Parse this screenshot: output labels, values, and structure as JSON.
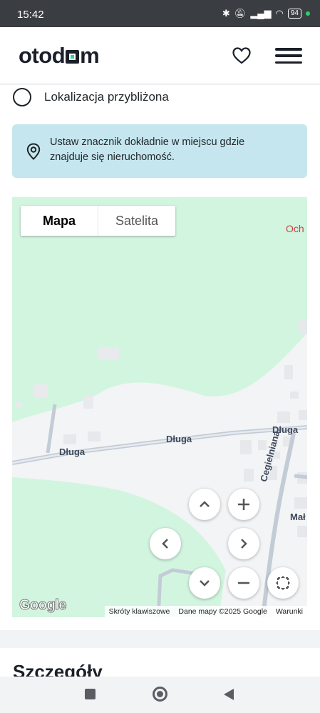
{
  "status_bar": {
    "time": "15:42",
    "battery": "94"
  },
  "header": {
    "logo_left": "otod",
    "logo_right": "m"
  },
  "location": {
    "radio_label": "Lokalizacja przybliżona"
  },
  "info_box": {
    "text": "Ustaw znacznik dokładnie w miejscu gdzie znajduje się nieruchomość."
  },
  "map": {
    "tabs": [
      "Mapa",
      "Satelita"
    ],
    "labels": {
      "partial_place": "Och",
      "street_1": "Długa",
      "street_2": "Długa",
      "street_3": "Długa",
      "street_4": "Cegielniana",
      "street_5": "Mał"
    },
    "google": "Google",
    "attribution": [
      "Skróty klawiszowe",
      "Dane mapy ©2025 Google",
      "Warunki"
    ]
  },
  "section": {
    "title": "Szczegóły"
  }
}
